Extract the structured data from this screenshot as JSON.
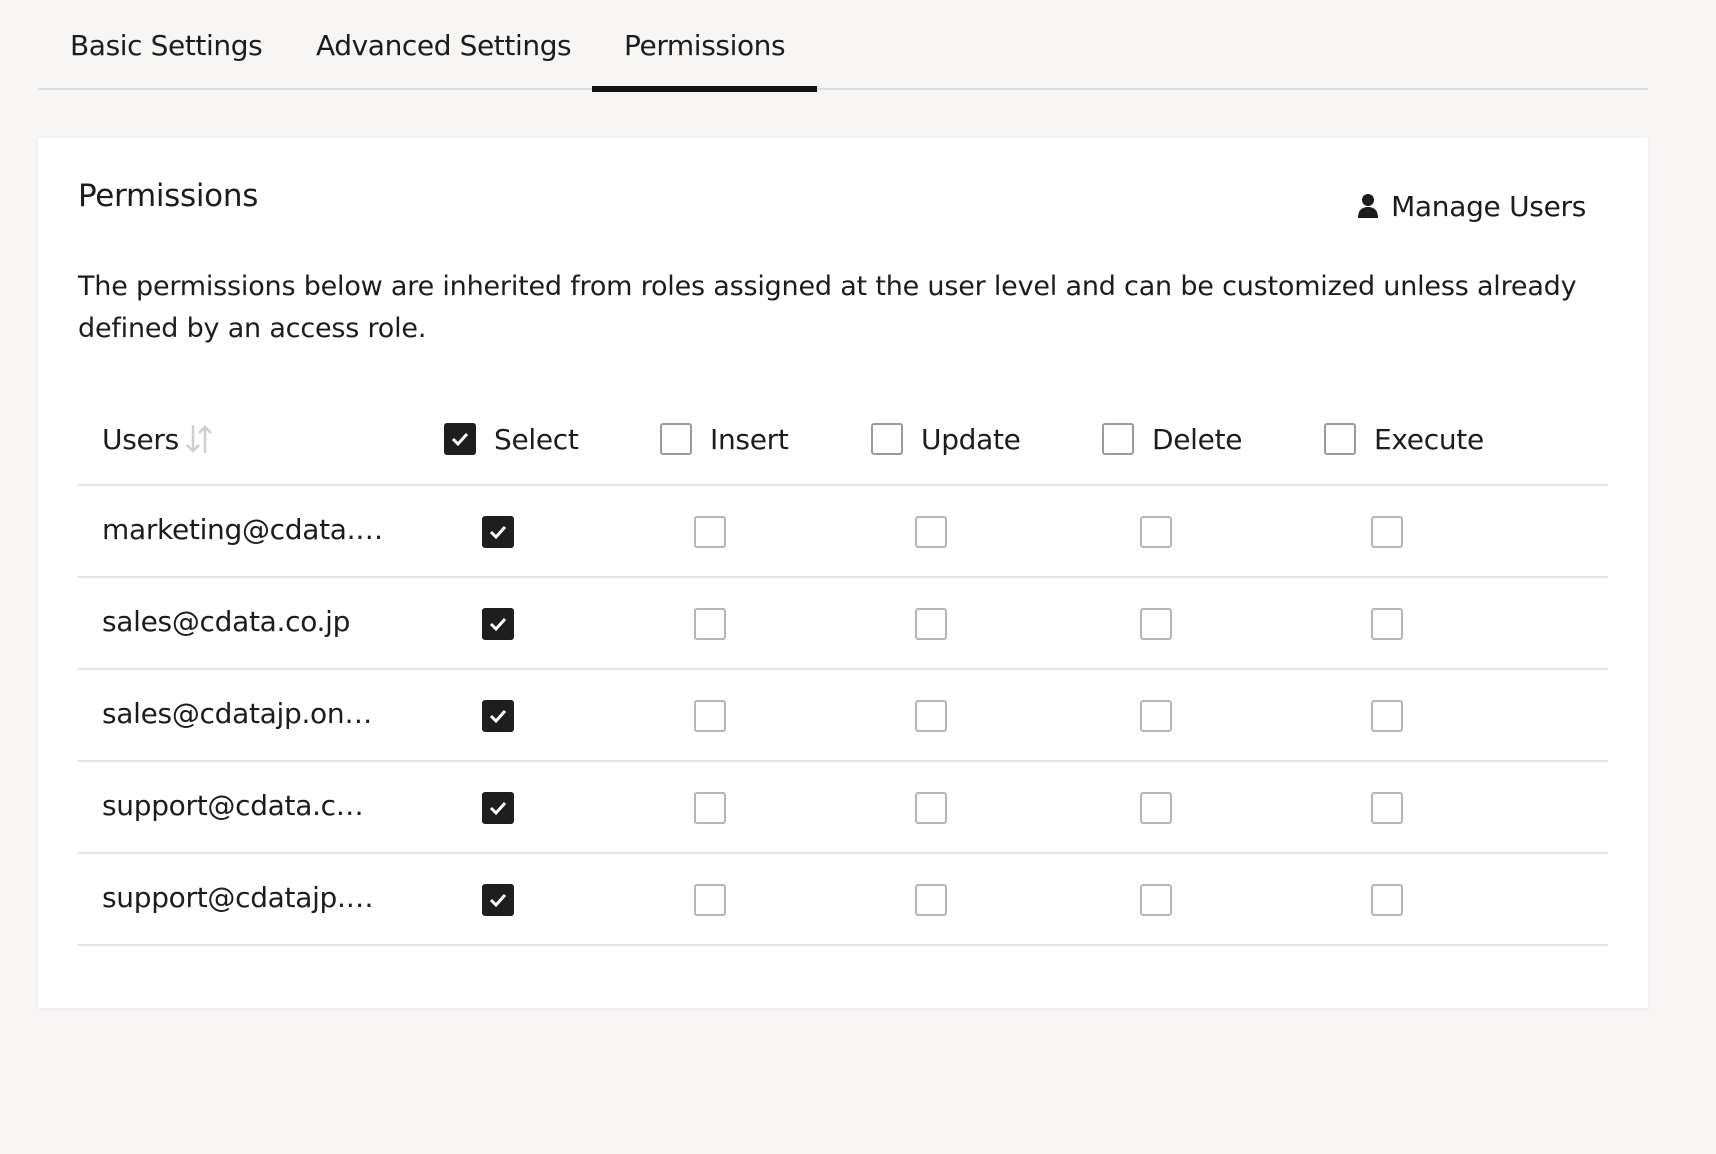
{
  "tabs": [
    {
      "label": "Basic Settings",
      "active": false
    },
    {
      "label": "Advanced Settings",
      "active": false
    },
    {
      "label": "Permissions",
      "active": true
    }
  ],
  "card": {
    "title": "Permissions",
    "manage_users_label": "Manage Users",
    "description": "The permissions below are inherited from roles assigned at the user level and can be customized unless already defined by an access role."
  },
  "table": {
    "users_header": "Users",
    "columns": [
      {
        "label": "Select",
        "checked": true
      },
      {
        "label": "Insert",
        "checked": false
      },
      {
        "label": "Update",
        "checked": false
      },
      {
        "label": "Delete",
        "checked": false
      },
      {
        "label": "Execute",
        "checked": false
      }
    ],
    "rows": [
      {
        "user": "marketing@cdata.…",
        "select": true,
        "insert": false,
        "update": false,
        "delete": false,
        "execute": false
      },
      {
        "user": "sales@cdata.co.jp",
        "select": true,
        "insert": false,
        "update": false,
        "delete": false,
        "execute": false
      },
      {
        "user": "sales@cdatajp.on…",
        "select": true,
        "insert": false,
        "update": false,
        "delete": false,
        "execute": false
      },
      {
        "user": "support@cdata.c…",
        "select": true,
        "insert": false,
        "update": false,
        "delete": false,
        "execute": false
      },
      {
        "user": "support@cdatajp.…",
        "select": true,
        "insert": false,
        "update": false,
        "delete": false,
        "execute": false
      }
    ]
  },
  "icons": {
    "user": "user-icon",
    "sort": "sort-icon",
    "check": "check-icon"
  }
}
